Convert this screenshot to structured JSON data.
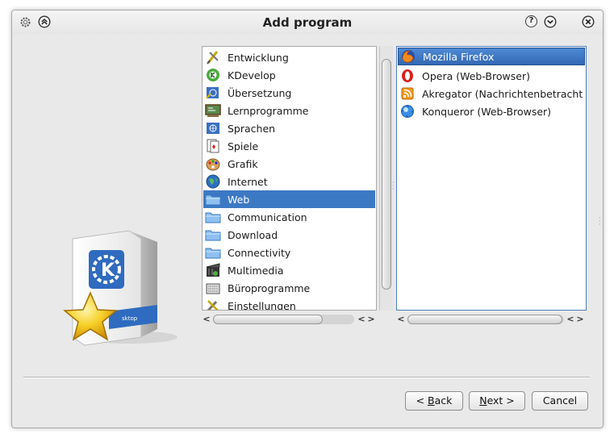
{
  "window": {
    "title": "Add program",
    "help_symbol": "?",
    "close_symbol": "✕",
    "menu_symbol": "⌃",
    "dropdown_symbol": "⌄"
  },
  "categories": {
    "items": [
      {
        "label": "Entwicklung",
        "icon": "development-tools-icon"
      },
      {
        "label": "KDevelop",
        "icon": "kdevelop-icon"
      },
      {
        "label": "Übersetzung",
        "icon": "translation-icon"
      },
      {
        "label": "Lernprogramme",
        "icon": "education-icon"
      },
      {
        "label": "Sprachen",
        "icon": "languages-icon"
      },
      {
        "label": "Spiele",
        "icon": "games-icon"
      },
      {
        "label": "Grafik",
        "icon": "graphics-icon"
      },
      {
        "label": "Internet",
        "icon": "internet-globe-icon"
      },
      {
        "label": "Web",
        "icon": "folder-icon"
      },
      {
        "label": "Communication",
        "icon": "folder-icon"
      },
      {
        "label": "Download",
        "icon": "folder-icon"
      },
      {
        "label": "Connectivity",
        "icon": "folder-icon"
      },
      {
        "label": "Multimedia",
        "icon": "multimedia-icon"
      },
      {
        "label": "Büroprogramme",
        "icon": "office-icon"
      },
      {
        "label": "Einstellungen",
        "icon": "settings-icon"
      }
    ],
    "selected": "Web"
  },
  "programs": {
    "items": [
      {
        "label": "Mozilla Firefox",
        "icon": "firefox-icon"
      },
      {
        "label": "Opera (Web-Browser)",
        "icon": "opera-icon"
      },
      {
        "label": "Akregator (Nachrichtenbetracht",
        "icon": "akregator-icon"
      },
      {
        "label": "Konqueror (Web-Browser)",
        "icon": "konqueror-icon"
      }
    ],
    "selected": "Mozilla Firefox"
  },
  "scroll_arrows": {
    "left": "<",
    "right": ">"
  },
  "buttons": {
    "back": {
      "prefix": "< ",
      "accel": "B",
      "rest": "ack"
    },
    "next": {
      "accel": "N",
      "rest": "ext >"
    },
    "cancel": "Cancel"
  },
  "artwork": {
    "box_label": "sktop"
  },
  "colors": {
    "selection": "#3c79c4",
    "window_bg": "#e9e9e9",
    "kde_blue": "#2f6bbf",
    "star": "#f3c217"
  }
}
